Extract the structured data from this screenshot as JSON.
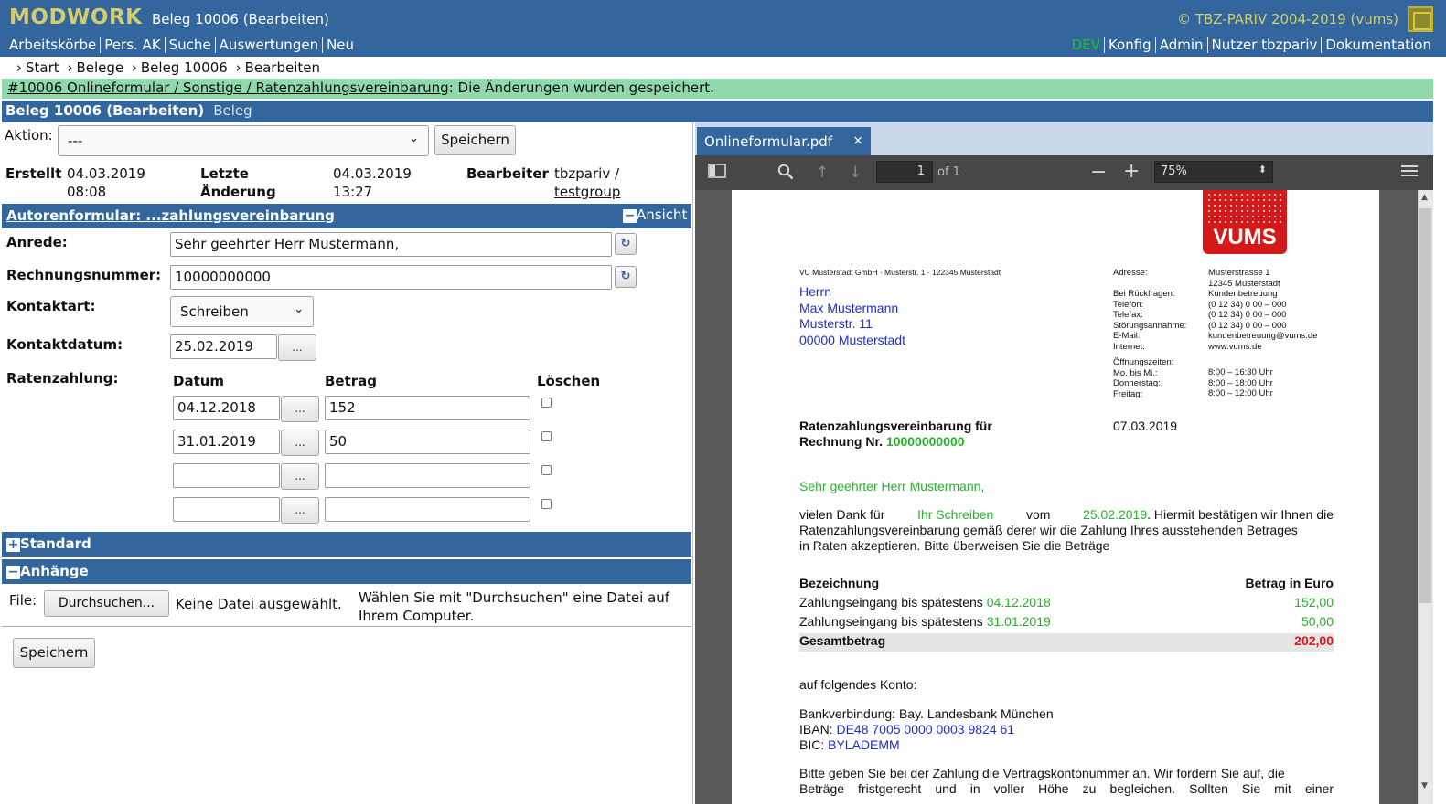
{
  "header": {
    "logo": "MODWORK",
    "title": "Beleg 10006 (Bearbeiten)",
    "copyright": "© TBZ-PARIV 2004-2019 (vums)",
    "nav_left": [
      "Arbeitskörbe",
      "Pers. AK",
      "Suche",
      "Auswertungen",
      "Neu"
    ],
    "nav_right": [
      "DEV",
      "Konfig",
      "Admin",
      "Nutzer tbzpariv",
      "Dokumentation"
    ]
  },
  "breadcrumb": [
    "Start",
    "Belege",
    "Beleg 10006",
    "Bearbeiten"
  ],
  "message": {
    "link": "#10006 Onlineformular / Sonstige / Ratenzahlungsvereinbarung",
    "text": ": Die Änderungen wurden gespeichert."
  },
  "section": {
    "title": "Beleg 10006 (Bearbeiten)",
    "subtitle": "Beleg"
  },
  "form": {
    "aktion_label": "Aktion:",
    "aktion_value": "---",
    "save_label": "Speichern",
    "erstellt_label": "Erstellt",
    "erstellt_date": "04.03.2019",
    "erstellt_time": "08:08",
    "letzte_label_1": "Letzte",
    "letzte_label_2": "Änderung",
    "letzte_date": "04.03.2019",
    "letzte_time": "13:27",
    "bearbeiter_label": "Bearbeiter",
    "bearbeiter_user": "tbzpariv /",
    "bearbeiter_group": "testgroup",
    "autoren_title": "Autorenformular: ...zahlungsvereinbarung",
    "ansicht_label": "Ansicht",
    "anrede_label": "Anrede:",
    "anrede_value": "Sehr geehrter Herr Mustermann,",
    "rechnung_label": "Rechnungsnummer:",
    "rechnung_value": "10000000000",
    "kontaktart_label": "Kontaktart:",
    "kontaktart_value": "Schreiben",
    "kontaktdatum_label": "Kontaktdatum:",
    "kontaktdatum_value": "25.02.2019",
    "dots": "...",
    "raten_label": "Ratenzahlung:",
    "col_datum": "Datum",
    "col_betrag": "Betrag",
    "col_loeschen": "Löschen",
    "raten": [
      {
        "datum": "04.12.2018",
        "betrag": "152"
      },
      {
        "datum": "31.01.2019",
        "betrag": "50"
      },
      {
        "datum": "",
        "betrag": ""
      },
      {
        "datum": "",
        "betrag": ""
      }
    ],
    "standard_label": "Standard",
    "anhaenge_label": "Anhänge",
    "file_label": "File:",
    "browse_label": "Durchsuchen...",
    "no_file": "Keine Datei ausgewählt.",
    "file_hint_1": "Wählen Sie mit \"Durchsuchen\" eine Datei auf",
    "file_hint_2": "Ihrem Computer.",
    "save_bottom": "Speichern"
  },
  "viewer": {
    "tab_title": "Onlineformular.pdf",
    "page": "1",
    "of": "of 1",
    "zoom": "75%"
  },
  "letter": {
    "logo_text": "VUMS",
    "sender_line": "VU Musterstadt GmbH · Musterstr. 1 · 122345 Musterstadt",
    "recipient": [
      "Herrn",
      "Max Mustermann",
      "Musterstr. 11",
      "00000 Musterstadt"
    ],
    "info_labels": [
      "Adresse:",
      "",
      "Bei Rückfragen:",
      "Telefon:",
      "Telefax:",
      "Störungsannahme:",
      "E-Mail:",
      "Internet:"
    ],
    "info_values": [
      "Musterstrasse 1",
      "12345 Musterstadt",
      "Kundenbetreuung",
      "(0 12 34) 0 00 – 000",
      "(0 12 34) 0 00 – 000",
      "(0 12 34) 0 00 – 000",
      "kundenbetreuung@vums.de",
      "www.vums.de"
    ],
    "hours_title": "Öffnungszeiten:",
    "hours_labels": [
      "Mo. bis Mi.:",
      "Donnerstag:",
      "Freitag:"
    ],
    "hours_values": [
      "8:00 – 16:30 Uhr",
      "8:00 – 18:00 Uhr",
      "8:00 – 12:00 Uhr"
    ],
    "subject_1": "Ratenzahlungsvereinbarung für",
    "subject_2": "Rechnung Nr.",
    "invoice_no": "10000000000",
    "letter_date": "07.03.2019",
    "salutation": "Sehr geehrter Herr Mustermann,",
    "body_1a": "vielen Dank für",
    "body_1b": "Ihr Schreiben",
    "body_1c": "vom",
    "body_1d": "25.02.2019",
    "body_1e": ". Hiermit bestätigen wir Ihnen die",
    "body_2": "Ratenzahlungsvereinbarung gemäß derer wir die Zahlung Ihres ausstehenden Betrages",
    "body_3": "in Raten akzeptieren. Bitte überweisen Sie die Beträge",
    "table_head_left": "Bezeichnung",
    "table_head_right": "Betrag in Euro",
    "rows": [
      {
        "text": "Zahlungseingang bis spätestens",
        "date": "04.12.2018",
        "amount": "152,00"
      },
      {
        "text": "Zahlungseingang bis spätestens",
        "date": "31.01.2019",
        "amount": "50,00"
      }
    ],
    "total_label": "Gesamtbetrag",
    "total_amount": "202,00",
    "account_intro": "auf folgendes Konto:",
    "bank_line": "Bankverbindung: Bay. Landesbank München",
    "iban_label": "IBAN:",
    "iban": "DE48 7005 0000 0003 9824 61",
    "bic_label": "BIC:",
    "bic": "BYLADEMM",
    "closing_1": "Bitte geben Sie bei der Zahlung die Vertragskontonummer an. Wir fordern Sie auf, die",
    "closing_2": "Beträge fristgerecht und in voller Höhe zu begleichen. Sollten Sie mit einer"
  },
  "colors": {
    "header_blue": "#33669c",
    "logo_gold": "#d4cd6d",
    "message_green": "#8fd9ac",
    "pdf_blue": "#1f2fc8",
    "pdf_green": "#27b22a",
    "total_red": "#e0141a"
  }
}
